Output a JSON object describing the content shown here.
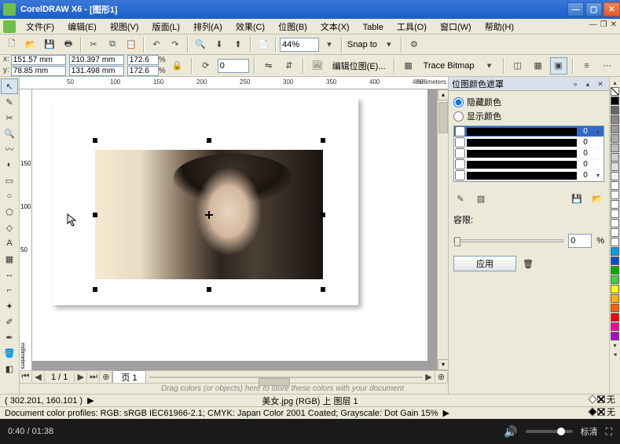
{
  "titlebar": {
    "app": "CorelDRAW X6",
    "doc": "[图形1]"
  },
  "menu": [
    "文件(F)",
    "编辑(E)",
    "视图(V)",
    "版面(L)",
    "排列(A)",
    "效果(C)",
    "位图(B)",
    "文本(X)",
    "Table",
    "工具(O)",
    "窗口(W)",
    "帮助(H)"
  ],
  "toolbar1": {
    "zoom": "44%",
    "snap": "Snap to"
  },
  "propbar": {
    "x": "151.57 mm",
    "y": "78.85 mm",
    "w": "210.397 mm",
    "h": "131.498 mm",
    "sx": "172.6",
    "sy": "172.6",
    "rot": "0",
    "edit_bitmap": "编辑位图(E)...",
    "trace": "Trace Bitmap"
  },
  "ruler": {
    "unit": "millimeters",
    "hticks": [
      "50",
      "100",
      "150",
      "200",
      "250",
      "300",
      "350",
      "400",
      "450"
    ],
    "vticks": [
      "50",
      "100",
      "150"
    ]
  },
  "page_tabs": {
    "counter": "1 / 1",
    "tab": "页 1"
  },
  "hint": "Drag colors (or objects) here to store these colors with your document",
  "status": {
    "cursor": "( 302.201, 160.101 )",
    "object": "美女.jpg (RGB) 上 图层 1",
    "profiles": "Document color profiles: RGB: sRGB IEC61966-2.1; CMYK: Japan Color 2001 Coated; Grayscale: Dot Gain 15%",
    "fill": "无",
    "outline": "无"
  },
  "docker": {
    "title": "位图颜色遮罩",
    "mode_hide": "隐藏颜色",
    "mode_show": "显示颜色",
    "rows": [
      {
        "val": "0",
        "sel": true
      },
      {
        "val": "0"
      },
      {
        "val": "0"
      },
      {
        "val": "0"
      },
      {
        "val": "0"
      }
    ],
    "tolerance_label": "容限:",
    "tolerance_val": "0",
    "tolerance_unit": "%",
    "apply": "应用"
  },
  "palette": [
    "#000",
    "#666",
    "#888",
    "#999",
    "#aaa",
    "#bbb",
    "#ccc",
    "#ddd",
    "#eee",
    "#fff",
    "#fff",
    "#fff",
    "#fff",
    "#fff",
    "#fff",
    "#fff",
    "#00a0e0",
    "#0050d0",
    "#00b000",
    "#40d040",
    "#ffff00",
    "#ffb000",
    "#ff6000",
    "#ff0000",
    "#ff00a0",
    "#b000d0"
  ],
  "player": {
    "current": "0:40",
    "total": "01:38",
    "quality": "标清"
  }
}
